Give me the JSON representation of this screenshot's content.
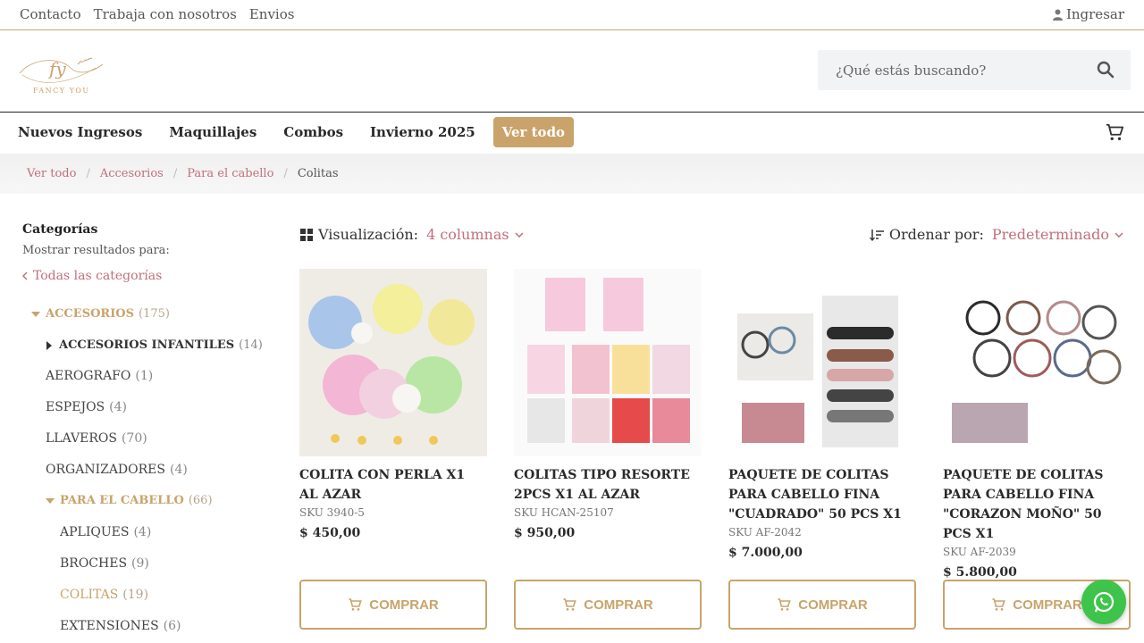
{
  "topbar": {
    "links": [
      "Contacto",
      "Trabaja con nosotros",
      "Envios"
    ],
    "login_label": "Ingresar"
  },
  "header": {
    "logo_text": "FANCY YOU",
    "search_placeholder": "¿Qué estás buscando?"
  },
  "nav": {
    "items": [
      "Nuevos Ingresos",
      "Maquillajes",
      "Combos",
      "Invierno 2025"
    ],
    "all_label": "Ver todo"
  },
  "breadcrumb": {
    "items": [
      "Ver todo",
      "Accesorios",
      "Para el cabello"
    ],
    "current": "Colitas"
  },
  "sidebar": {
    "title": "Categorías",
    "subtitle": "Mostrar resultados para:",
    "all_categories": "Todas las categorías",
    "categories": [
      {
        "label": "ACCESORIOS",
        "count": "(175)"
      },
      {
        "label": "ACCESORIOS INFANTILES",
        "count": "(14)"
      },
      {
        "label": "AEROGRAFO",
        "count": "(1)"
      },
      {
        "label": "ESPEJOS",
        "count": "(4)"
      },
      {
        "label": "LLAVEROS",
        "count": "(70)"
      },
      {
        "label": "ORGANIZADORES",
        "count": "(4)"
      },
      {
        "label": "PARA EL CABELLO",
        "count": "(66)"
      },
      {
        "label": "APLIQUES",
        "count": "(4)"
      },
      {
        "label": "BROCHES",
        "count": "(9)"
      },
      {
        "label": "COLITAS",
        "count": "(19)"
      },
      {
        "label": "EXTENSIONES",
        "count": "(6)"
      }
    ]
  },
  "toolbar": {
    "view_label": "Visualización:",
    "view_value": "4 columnas",
    "sort_label": "Ordenar por:",
    "sort_value": "Predeterminado"
  },
  "products": [
    {
      "name": "COLITA CON PERLA X1 AL AZAR",
      "sku": "SKU 3940-5",
      "price": "$  450,00"
    },
    {
      "name": "COLITAS TIPO RESORTE 2PCS X1 AL AZAR",
      "sku": "SKU HCAN-25107",
      "price": "$  950,00"
    },
    {
      "name": "PAQUETE DE COLITAS PARA CABELLO FINA \"CUADRADO\" 50 PCS X1",
      "sku": "SKU AF-2042",
      "price": "$  7.000,00"
    },
    {
      "name": "PAQUETE DE COLITAS PARA CABELLO FINA \"CORAZON MOÑO\" 50 PCS X1",
      "sku": "SKU AF-2039",
      "price": "$  5.800,00"
    }
  ],
  "buy_label": "COMPRAR",
  "colors": {
    "accent": "#c9a36a",
    "link": "#c0707a",
    "whatsapp": "#3ec44a"
  }
}
